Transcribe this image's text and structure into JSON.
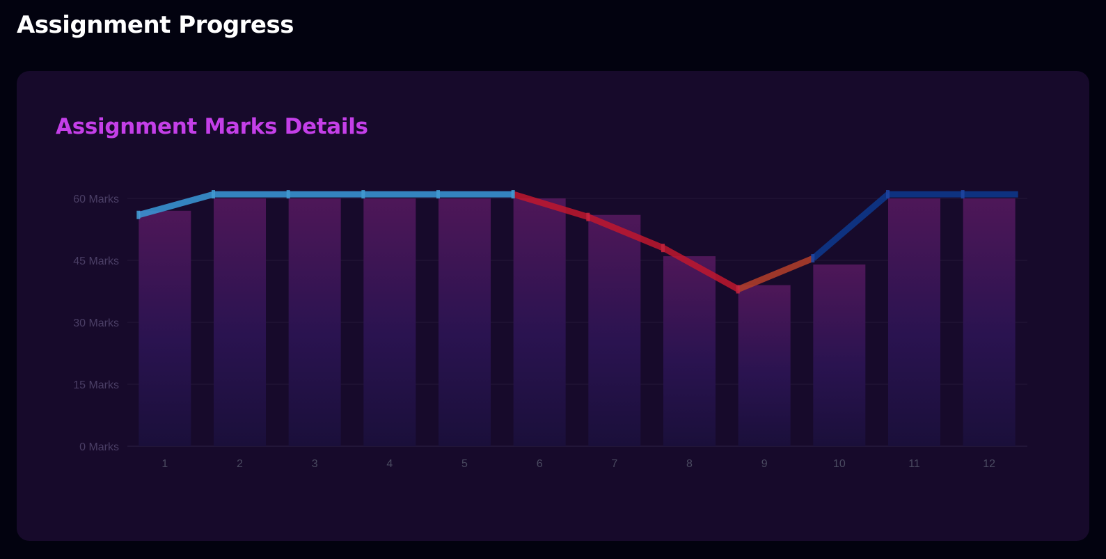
{
  "page": {
    "heading": "Assignment Progress"
  },
  "card": {
    "title": "Assignment Marks Details"
  },
  "colors": {
    "background": "#02020f",
    "card": "#170a2b",
    "title_accent": "#c43fe8",
    "bar_top": "#4e1758",
    "bar_bottom": "#1a0f3a",
    "line_rising": "#3a9ad9",
    "line_falling": "#c0182e",
    "line_recovering": "#0d3a8f"
  },
  "chart_data": {
    "type": "bar",
    "title": "Assignment Marks Details",
    "xlabel": "",
    "ylabel": "",
    "categories": [
      "1",
      "2",
      "3",
      "4",
      "5",
      "6",
      "7",
      "8",
      "9",
      "10",
      "11",
      "12"
    ],
    "series": [
      {
        "type": "bar",
        "values": [
          57,
          60,
          60,
          60,
          60,
          60,
          56,
          46,
          39,
          44,
          60,
          60
        ]
      },
      {
        "type": "line",
        "values": [
          56,
          61,
          61,
          61,
          61,
          61,
          55.5,
          48,
          38,
          45.5,
          61,
          61
        ]
      }
    ],
    "ylim": [
      0,
      60
    ],
    "yticks": [
      0,
      15,
      30,
      45,
      60
    ],
    "ytick_suffix": " Marks",
    "grid": true,
    "legend": "none"
  }
}
